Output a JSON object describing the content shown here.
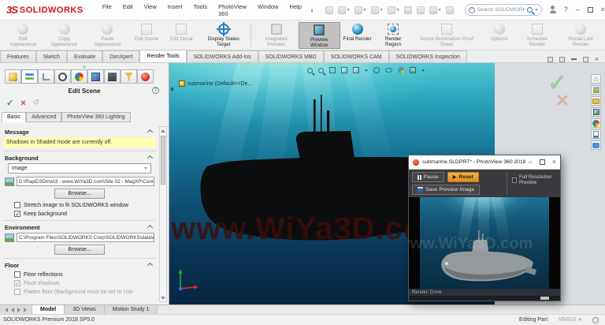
{
  "header": {
    "logo_mark": "3S",
    "logo_text": "SOLIDWORKS",
    "menus": [
      {
        "label": "File"
      },
      {
        "label": "Edit"
      },
      {
        "label": "View"
      },
      {
        "label": "Insert"
      },
      {
        "label": "Tools"
      },
      {
        "label": "PhotoView 360"
      },
      {
        "label": "Window"
      },
      {
        "label": "Help"
      }
    ],
    "search_placeholder": "Search SOLIDWORKS Help"
  },
  "ribbon": {
    "buttons": [
      {
        "label": "Edit Appearance",
        "state": "disabled"
      },
      {
        "label": "Copy Appearance",
        "state": "disabled"
      },
      {
        "label": "Paste Appearance",
        "state": "disabled"
      },
      {
        "label": "Edit Scene",
        "state": "disabled"
      },
      {
        "label": "Edit Decal",
        "state": "disabled"
      },
      {
        "label": "Display States Target",
        "state": "enabled"
      },
      {
        "label": "Integrated Preview",
        "state": "disabled"
      },
      {
        "label": "Preview Window",
        "state": "active"
      },
      {
        "label": "Final Render",
        "state": "enabled"
      },
      {
        "label": "Render Region",
        "state": "enabled"
      },
      {
        "label": "Scene Illumination Proof Sheet",
        "state": "disabled"
      },
      {
        "label": "Options",
        "state": "disabled"
      },
      {
        "label": "Schedule Render",
        "state": "disabled"
      },
      {
        "label": "Recall Last Render",
        "state": "disabled"
      }
    ]
  },
  "doc_tabs": [
    {
      "label": "Features"
    },
    {
      "label": "Sketch"
    },
    {
      "label": "Evaluate"
    },
    {
      "label": "DimXpert"
    },
    {
      "label": "Render Tools",
      "active": true
    },
    {
      "label": "SOLIDWORKS Add-Ins"
    },
    {
      "label": "SOLIDWORKS MBD"
    },
    {
      "label": "SOLIDWORKS CAM"
    },
    {
      "label": "SOLIDWORKS Inspection"
    }
  ],
  "pm": {
    "title": "Edit Scene",
    "tabs": [
      {
        "label": "Basic",
        "active": true
      },
      {
        "label": "Advanced"
      },
      {
        "label": "PhotoView 360 Lighting"
      }
    ],
    "message": {
      "title": "Message",
      "text": "Shadows in Shaded mode are currently off."
    },
    "background": {
      "title": "Background",
      "type": "Image",
      "path": "D:\\RapiD3Dmw\\3 - www.WiYa3D.com\\Site 02 - MagXP\\Cont",
      "browse": "Browse...",
      "stretch": "Stretch image to fit SOLIDWORKS window",
      "keep": "Keep background"
    },
    "environment": {
      "title": "Environment",
      "path": "C:\\Program Files\\SOLIDWORKS Corp\\SOLIDWORKS\\data\\i",
      "browse": "Browse..."
    },
    "floor": {
      "title": "Floor",
      "reflections": "Floor reflections",
      "shadows": "Floor shadows",
      "flatten": "Flatten floor (Background must be set to Use"
    }
  },
  "viewport": {
    "part_label": "submarine (Default<<De...",
    "watermark": "www.WiYa3D.com"
  },
  "preview": {
    "title": "submarine.SLDPRT* - PhotoView 360 2018",
    "pause": "Pause",
    "reset": "Reset",
    "full_res": "Full Resolution Preview",
    "save": "Save Preview Image",
    "render_status": "Render: Done"
  },
  "bottom_tabs": [
    {
      "label": "Model",
      "active": true
    },
    {
      "label": "3D Views"
    },
    {
      "label": "Motion Study 1"
    }
  ],
  "status_bar": {
    "product": "SOLIDWORKS Premium 2018 SP5.0",
    "mode": "Editing Part",
    "units": "MMGS"
  },
  "icons": {
    "close": "×",
    "minimize": "–",
    "undo": "↺",
    "play": "▶",
    "help": "?",
    "home": "⌂",
    "check": "✓",
    "cross": "×"
  },
  "colors": {
    "logo_red": "#d6131b",
    "reset_orange": "#e79b28",
    "viewport_teal_top": "#55c9d1",
    "viewport_navy_bottom": "#082642",
    "watermark": "#3f0e0a",
    "message_yellow": "#feffb0"
  }
}
